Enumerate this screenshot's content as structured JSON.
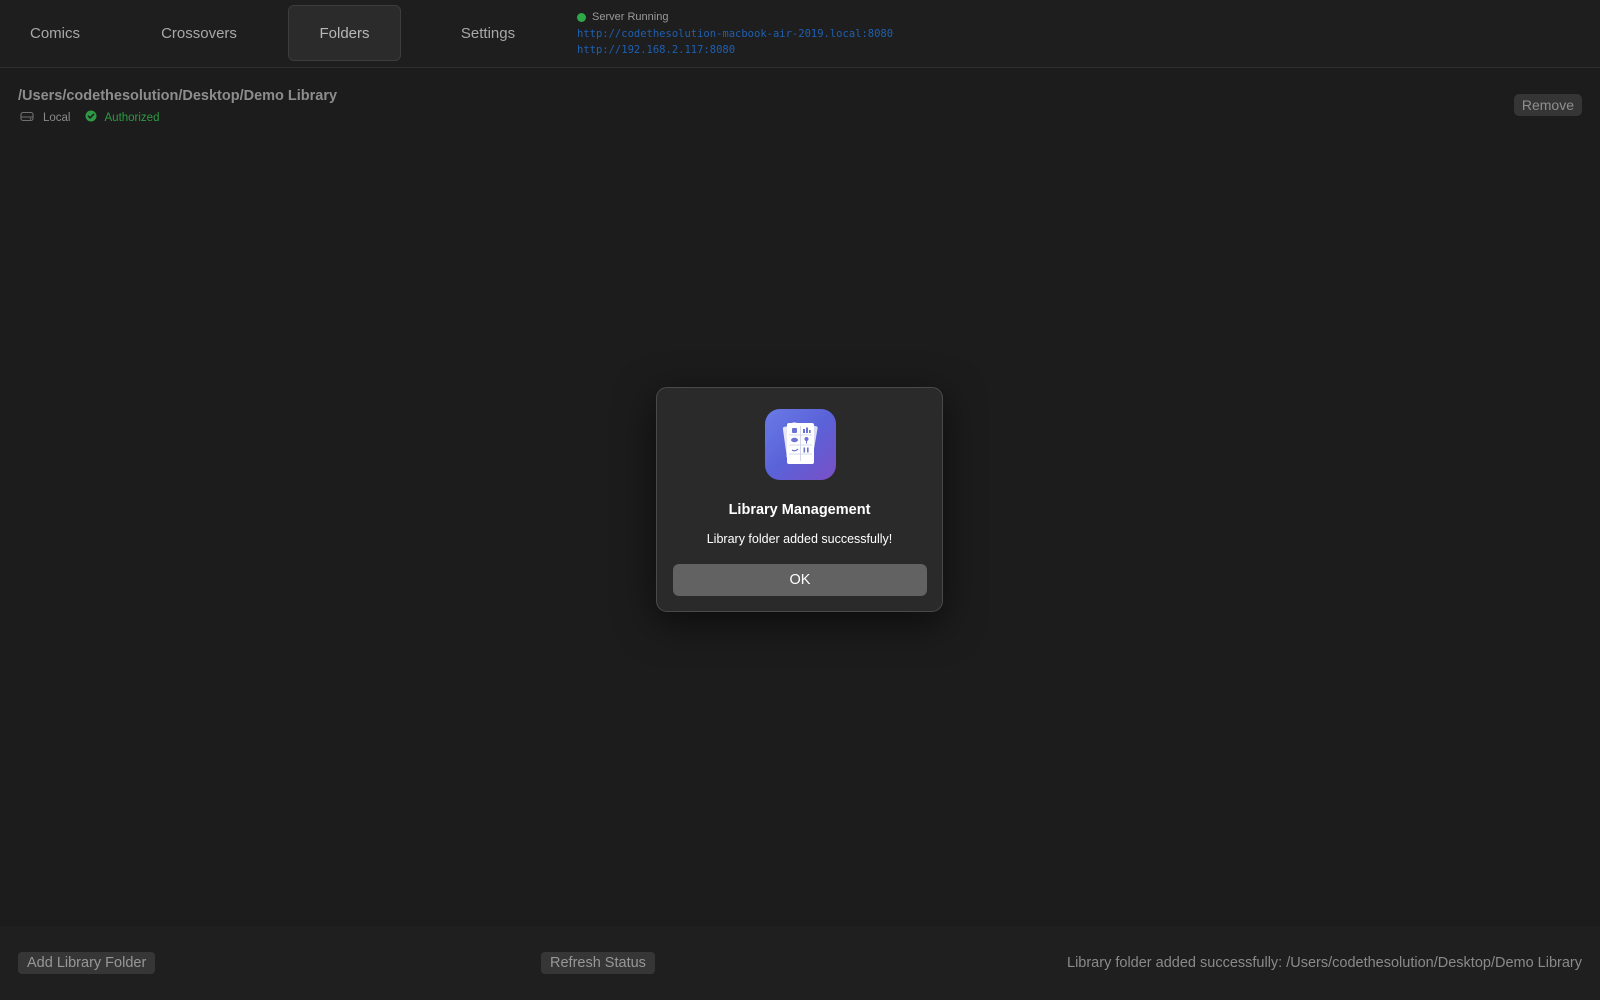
{
  "tabs": [
    {
      "label": "Comics",
      "active": false
    },
    {
      "label": "Crossovers",
      "active": false
    },
    {
      "label": "Folders",
      "active": true
    },
    {
      "label": "Settings",
      "active": false
    }
  ],
  "server": {
    "status": "Server Running",
    "status_color": "#2fa84a",
    "urls": [
      "http://codethesolution-macbook-air-2019.local:8080",
      "http://192.168.2.117:8080"
    ]
  },
  "folder": {
    "path": "/Users/codethesolution/Desktop/Demo Library",
    "location_icon": "drive-icon",
    "location": "Local",
    "auth_icon": "check-circle-icon",
    "auth": "Authorized",
    "auth_color": "#2e9a45",
    "remove_label": "Remove"
  },
  "bottom": {
    "add_label": "Add Library Folder",
    "refresh_label": "Refresh Status",
    "status": "Library folder added successfully: /Users/codethesolution/Desktop/Demo Library"
  },
  "modal": {
    "icon": "comic-library-app-icon",
    "title": "Library Management",
    "message": "Library folder added successfully!",
    "ok_label": "OK"
  }
}
